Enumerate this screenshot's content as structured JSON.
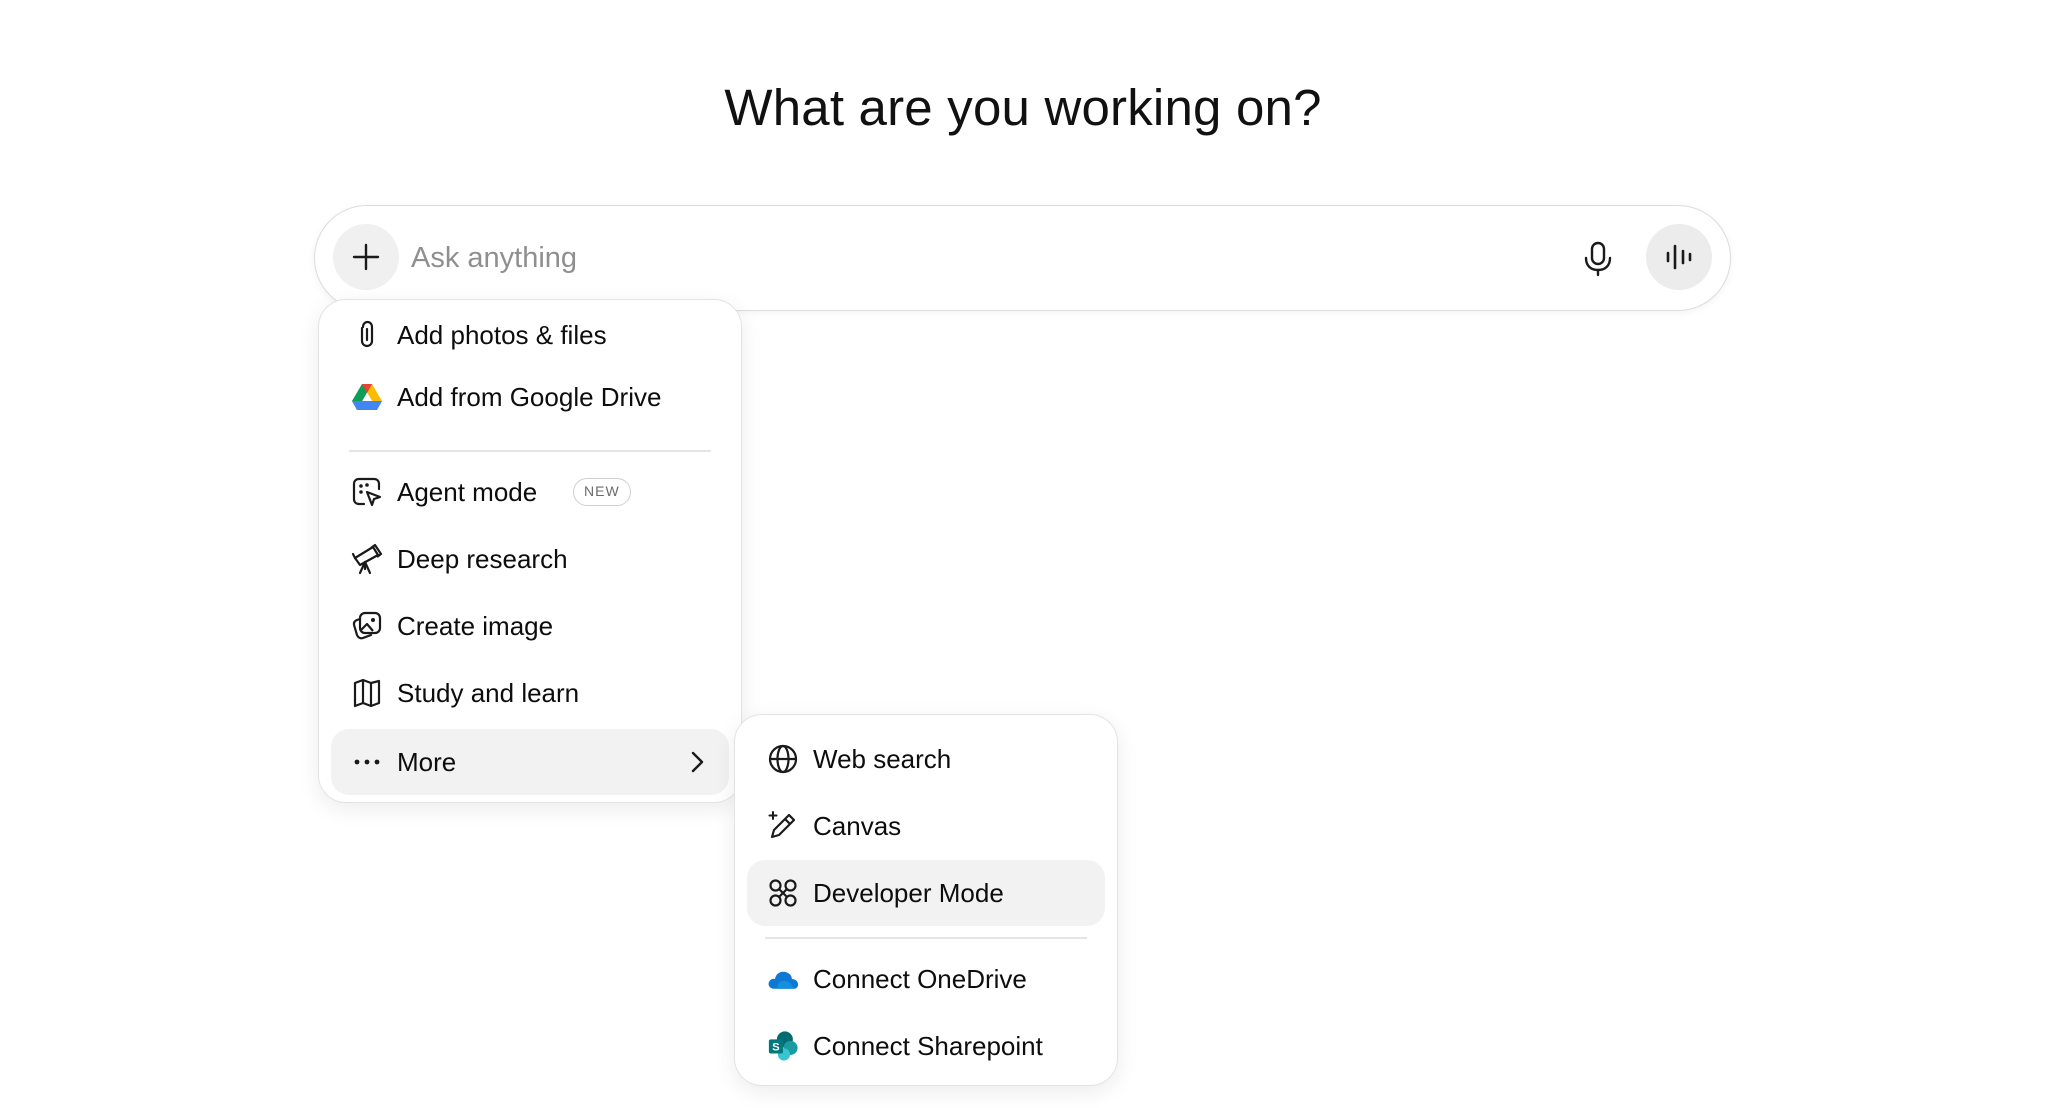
{
  "headline": "What are you working on?",
  "composer": {
    "placeholder": "Ask anything",
    "value": ""
  },
  "menu": {
    "items": [
      {
        "label": "Add photos & files",
        "icon": "paperclip-icon"
      },
      {
        "label": "Add from Google Drive",
        "icon": "google-drive-icon"
      },
      {
        "label": "Agent mode",
        "icon": "agent-cursor-icon",
        "badge": "NEW"
      },
      {
        "label": "Deep research",
        "icon": "telescope-icon"
      },
      {
        "label": "Create image",
        "icon": "image-icon"
      },
      {
        "label": "Study and learn",
        "icon": "book-icon"
      },
      {
        "label": "More",
        "icon": "ellipsis-icon",
        "submenu": true
      }
    ]
  },
  "submenu": {
    "items": [
      {
        "label": "Web search",
        "icon": "globe-icon"
      },
      {
        "label": "Canvas",
        "icon": "pencil-sparkle-icon"
      },
      {
        "label": "Developer Mode",
        "icon": "command-icon",
        "highlighted": true
      },
      {
        "label": "Connect OneDrive",
        "icon": "onedrive-icon"
      },
      {
        "label": "Connect Sharepoint",
        "icon": "sharepoint-icon"
      }
    ]
  },
  "colors": {
    "text": "#0d0d0d",
    "placeholder": "#8f8f8f",
    "highlight": "#f2f2f2",
    "button_bg": "#f0f0f0",
    "onedrive": "#0f78d4",
    "sharepoint": "#038387"
  }
}
